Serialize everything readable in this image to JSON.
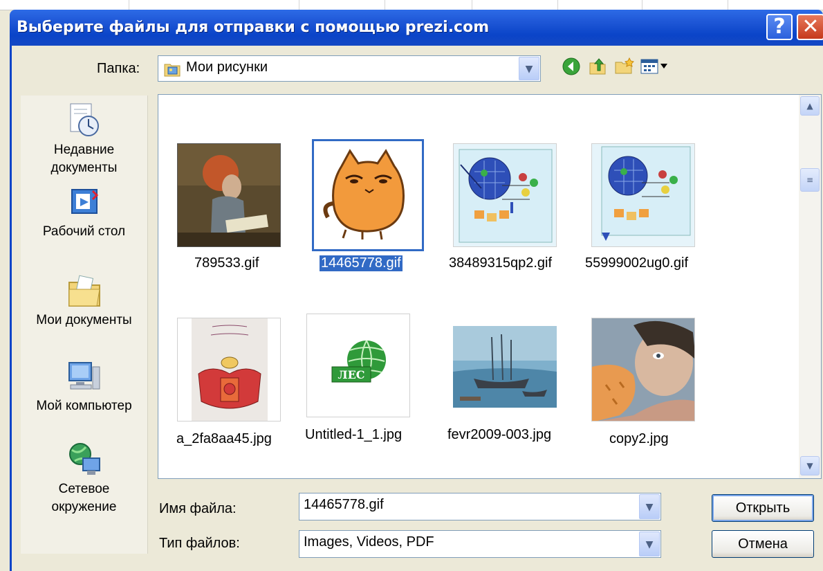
{
  "window": {
    "title": "Выберите файлы для отправки с помощью prezi.com",
    "help_glyph": "?",
    "close_glyph": "✕"
  },
  "lookin": {
    "label": "Папка:",
    "value": "Мои рисунки"
  },
  "places": [
    {
      "label": "Недавние документы",
      "icon": "recent-documents-icon"
    },
    {
      "label": "Рабочий стол",
      "icon": "desktop-icon"
    },
    {
      "label": "Мои документы",
      "icon": "my-documents-icon"
    },
    {
      "label": "Мой компьютер",
      "icon": "my-computer-icon"
    },
    {
      "label": "Сетевое окружение",
      "icon": "network-places-icon"
    }
  ],
  "files": [
    {
      "name": "789533.gif",
      "selected": false
    },
    {
      "name": "14465778.gif",
      "selected": true
    },
    {
      "name": "38489315qp2.gif",
      "selected": false
    },
    {
      "name": "55999002ug0.gif",
      "selected": false
    },
    {
      "name": "a_2fa8aa45.jpg",
      "selected": false
    },
    {
      "name": "Untitled-1_1.jpg",
      "selected": false
    },
    {
      "name": "fevr2009-003.jpg",
      "selected": false
    },
    {
      "name": "copy2.jpg",
      "selected": false
    }
  ],
  "thumb_texts": {
    "wiki_logo": "ЛЕС"
  },
  "filename": {
    "label": "Имя файла:",
    "value": "14465778.gif"
  },
  "filetype": {
    "label": "Тип файлов:",
    "value": "Images, Videos, PDF"
  },
  "buttons": {
    "open": "Открыть",
    "cancel": "Отмена"
  },
  "colors": {
    "titlebar": "#0a44c8",
    "selection": "#316ac5",
    "face": "#ece9d8"
  }
}
